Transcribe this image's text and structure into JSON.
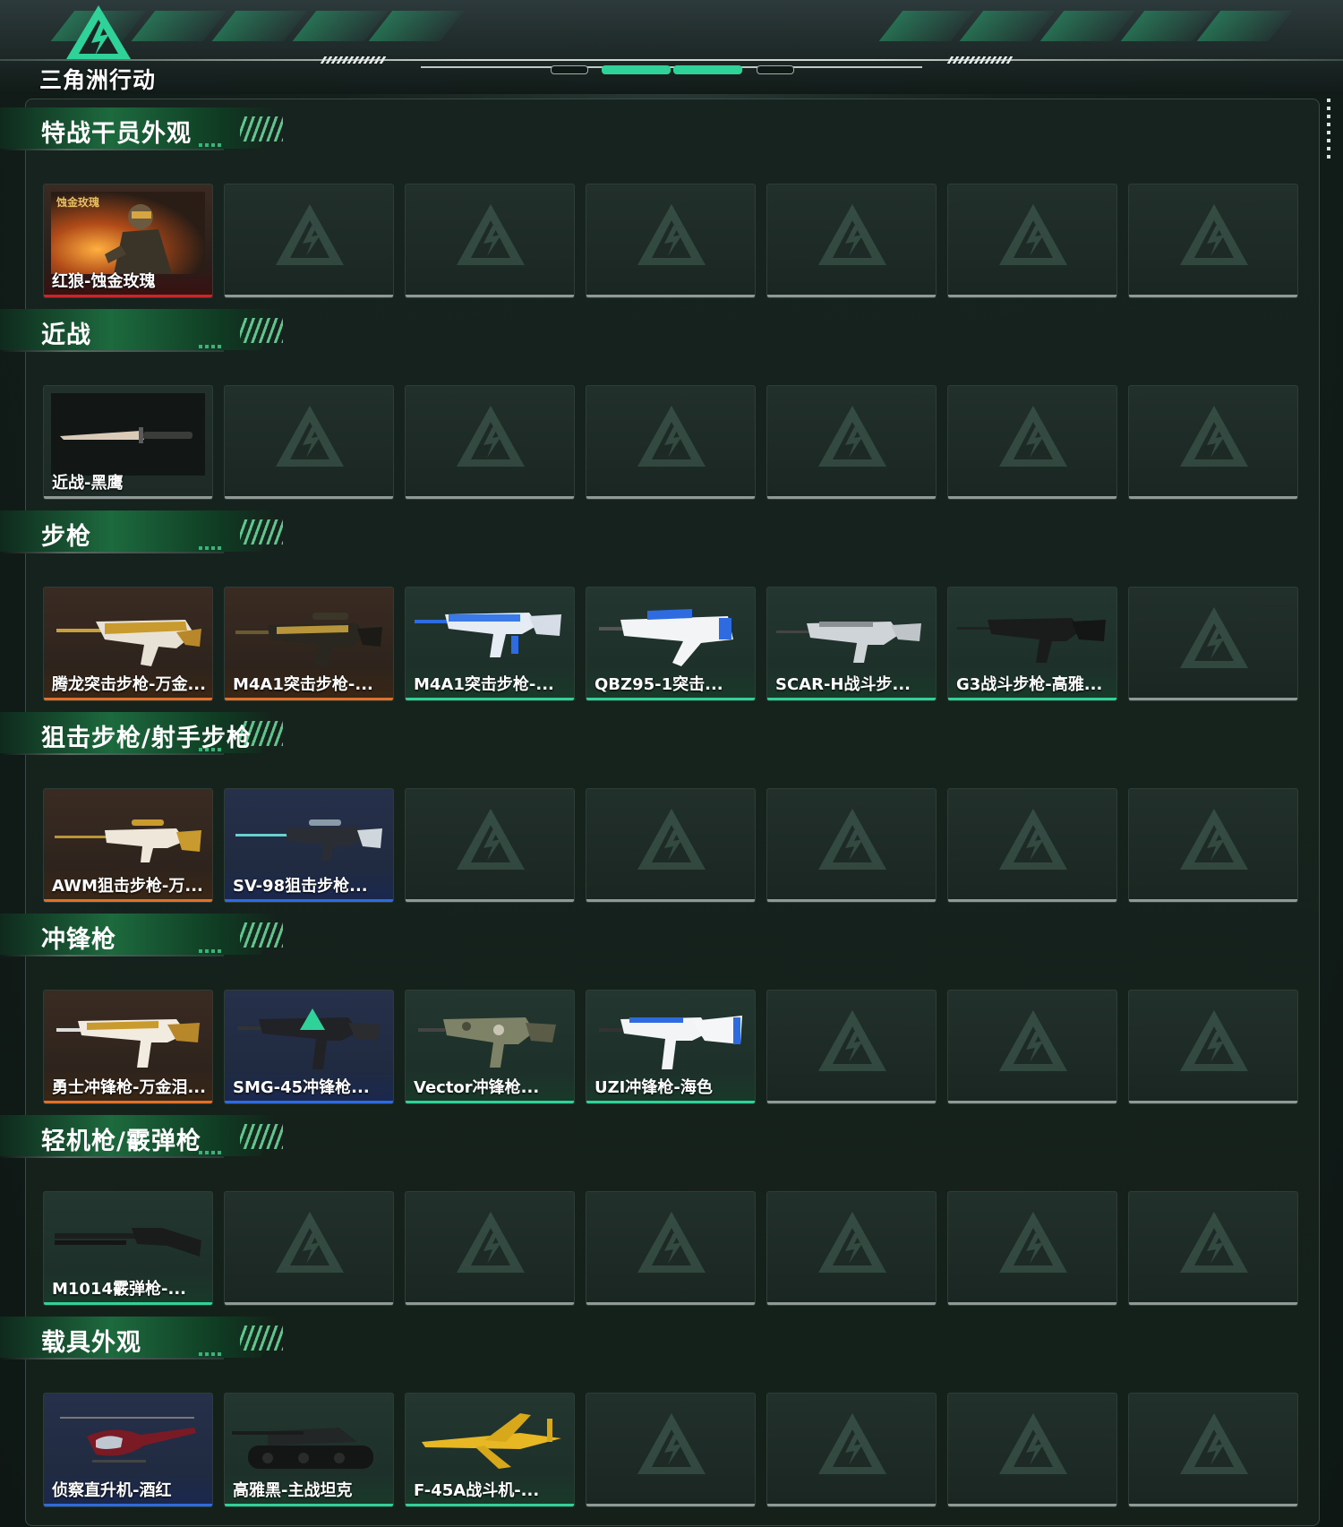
{
  "brand": {
    "logo_text": "三角洲行动",
    "accent": "#2fd39a",
    "logo_icon": "delta-triangle-logo-icon"
  },
  "colors": {
    "red": "#c8262a",
    "orange": "#e0702a",
    "green": "#2fd39a",
    "blue": "#2f6be0",
    "gray": "#8f9a96"
  },
  "sections": [
    {
      "title": "特战干员外观",
      "items": [
        {
          "label": "红狼-蚀金玫瑰",
          "rarity": "red",
          "art": "operator",
          "badge": "蚀金玫瑰"
        }
      ]
    },
    {
      "title": "近战",
      "items": [
        {
          "label": "近战-黑鹰",
          "rarity": "gray",
          "art": "knife"
        }
      ]
    },
    {
      "title": "步枪",
      "items": [
        {
          "label": "腾龙突击步枪-万金...",
          "rarity": "orange",
          "art": "rifle-gold"
        },
        {
          "label": "M4A1突击步枪-...",
          "rarity": "orange",
          "art": "rifle-gold-black"
        },
        {
          "label": "M4A1突击步枪-...",
          "rarity": "green",
          "art": "rifle-blue"
        },
        {
          "label": "QBZ95-1突击...",
          "rarity": "green",
          "art": "bullpup-white"
        },
        {
          "label": "SCAR-H战斗步...",
          "rarity": "green",
          "art": "rifle-silver"
        },
        {
          "label": "G3战斗步枪-高雅...",
          "rarity": "green",
          "art": "rifle-black"
        }
      ]
    },
    {
      "title": "狙击步枪/射手步枪",
      "items": [
        {
          "label": "AWM狙击步枪-万...",
          "rarity": "orange",
          "art": "sniper-gold"
        },
        {
          "label": "SV-98狙击步枪...",
          "rarity": "blue",
          "art": "sniper-dark"
        }
      ]
    },
    {
      "title": "冲锋枪",
      "items": [
        {
          "label": "勇士冲锋枪-万金泪...",
          "rarity": "orange",
          "art": "smg-gold"
        },
        {
          "label": "SMG-45冲锋枪...",
          "rarity": "blue",
          "art": "smg-black"
        },
        {
          "label": "Vector冲锋枪...",
          "rarity": "green",
          "art": "smg-camo"
        },
        {
          "label": "UZI冲锋枪-海色",
          "rarity": "green",
          "art": "smg-white"
        }
      ]
    },
    {
      "title": "轻机枪/霰弹枪",
      "items": [
        {
          "label": "M1014霰弹枪-...",
          "rarity": "green",
          "art": "shotgun"
        }
      ]
    },
    {
      "title": "载具外观",
      "items": [
        {
          "label": "侦察直升机-酒红",
          "rarity": "blue",
          "art": "helicopter"
        },
        {
          "label": "高雅黑-主战坦克",
          "rarity": "green",
          "art": "tank"
        },
        {
          "label": "F-45A战斗机-...",
          "rarity": "green",
          "art": "jet"
        }
      ]
    }
  ]
}
